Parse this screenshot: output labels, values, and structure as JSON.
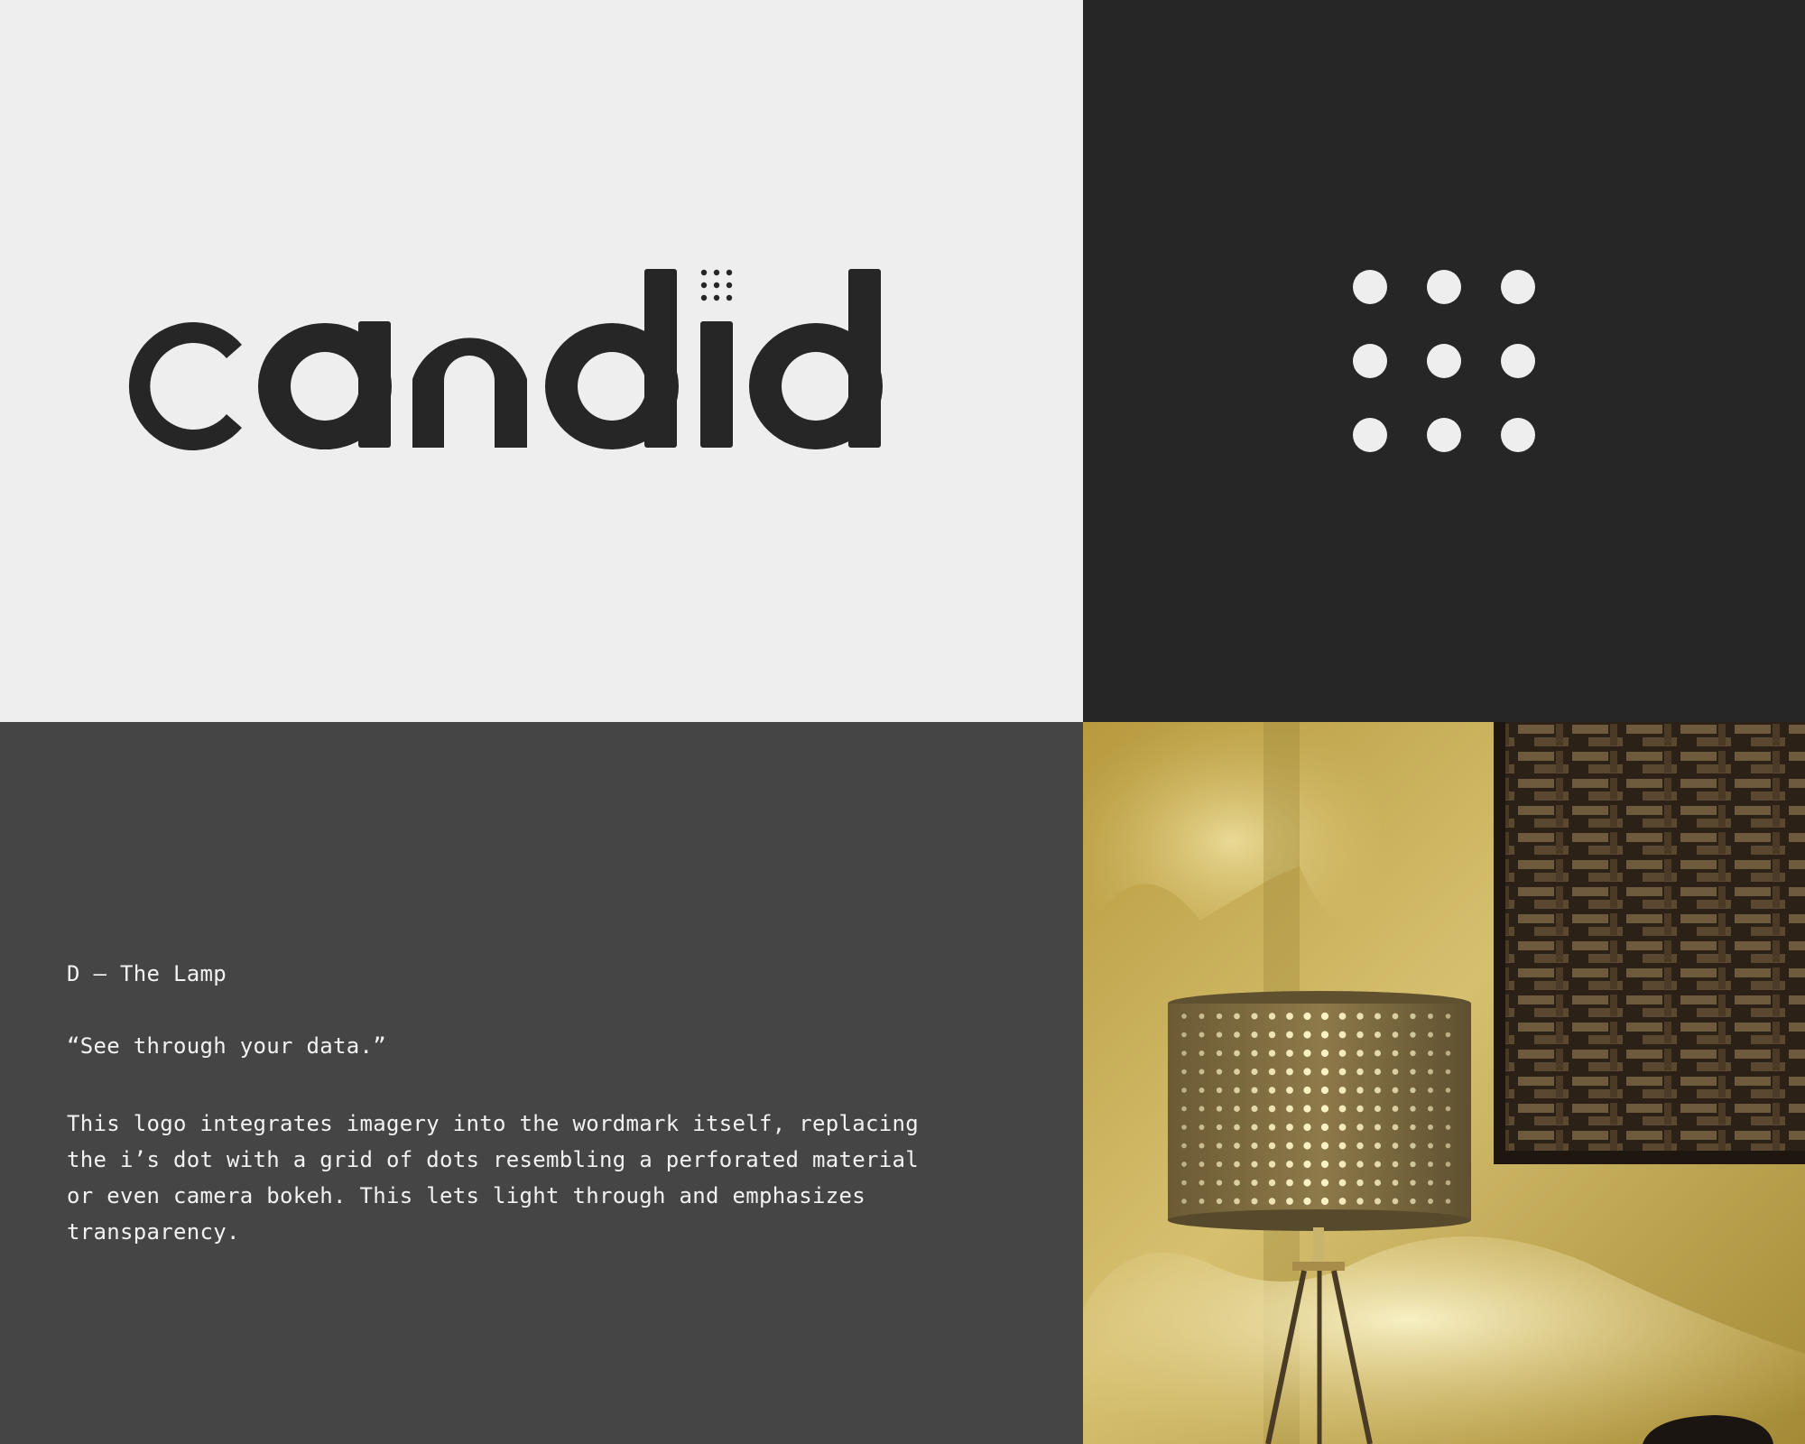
{
  "logo": {
    "wordmark": "candid",
    "colors": {
      "ink": "#262626",
      "light": "#eeeeee"
    }
  },
  "description": {
    "heading": "D – The Lamp",
    "tagline": "“See through your data.”",
    "body": "This logo integrates imagery into the wordmark itself, replacing the i’s dot with a grid of dots resembling a perforated material or even camera bokeh. This lets light through and emphasizes transparency."
  },
  "photo": {
    "subject": "perforated lamp shade casting light beside a woven wooden panel"
  },
  "colors": {
    "panel_light": "#eeeeee",
    "panel_dark": "#262626",
    "panel_mid": "#454545",
    "text": "#f2f2f2"
  }
}
